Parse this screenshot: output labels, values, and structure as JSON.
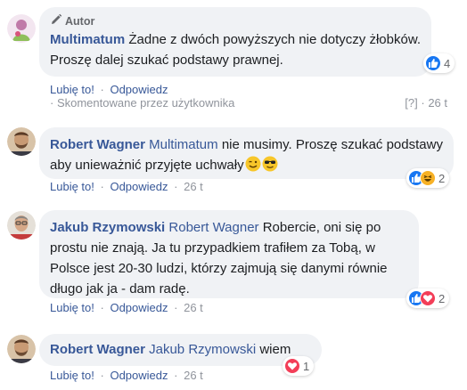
{
  "comments": [
    {
      "badge": "Autor",
      "author": "Multimatum",
      "tag": "",
      "text": "Żadne z dwóch powyższych nie dotyczy żłobków. Proszę dalej szukać podstawy prawnej.",
      "like_label": "Lubię to!",
      "reply_label": "Odpowiedz",
      "time": "",
      "commented_by": "· Skomentowane przez użytkownika",
      "help": "[?]",
      "meta_time": "· 26 t",
      "reaction_count": "4"
    },
    {
      "author": "Robert Wagner",
      "tag": "Multimatum",
      "text": "nie musimy. Proszę szukać podstawy aby unieważnić przyjęte uchwały",
      "like_label": "Lubię to!",
      "reply_label": "Odpowiedz",
      "time": "26 t",
      "reaction_count": "2"
    },
    {
      "author": "Jakub Rzymowski",
      "tag": "Robert Wagner",
      "text": "Robercie, oni się po prostu nie znają. Ja tu przypadkiem trafiłem za Tobą, w Polsce jest 20-30 ludzi, którzy zajmują się danymi równie długo jak ja - dam radę.",
      "like_label": "Lubię to!",
      "reply_label": "Odpowiedz",
      "time": "26 t",
      "reaction_count": "2"
    },
    {
      "author": "Robert Wagner",
      "tag": "Jakub Rzymowski",
      "text": "wiem",
      "like_label": "Lubię to!",
      "reply_label": "Odpowiedz",
      "time": "26 t",
      "reaction_count": "1"
    }
  ],
  "separator": "·",
  "colors": {
    "link": "#385898",
    "bubble": "#f0f2f5",
    "like": "#1877f2",
    "love": "#f33e58",
    "haha": "#f7b125"
  },
  "icons": [
    "pencil-icon",
    "like-reaction-icon",
    "haha-reaction-icon",
    "love-reaction-icon",
    "wink-emoji",
    "sunglasses-emoji"
  ]
}
